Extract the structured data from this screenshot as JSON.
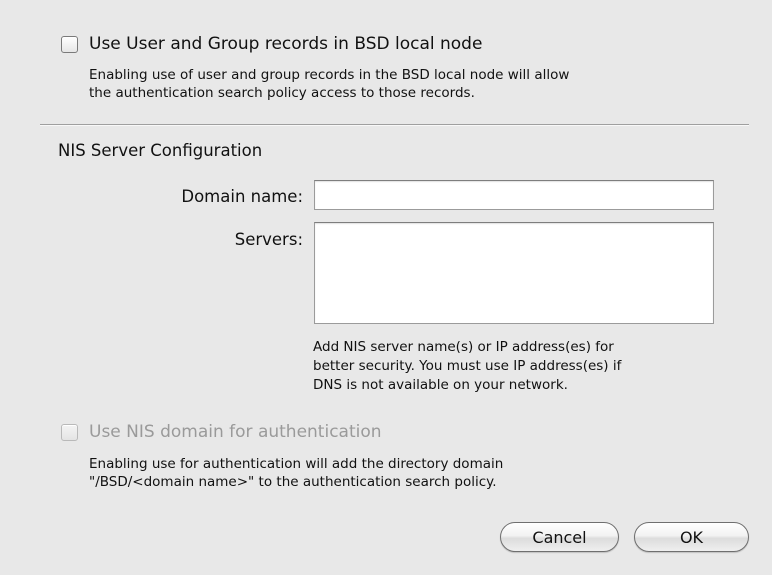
{
  "bsd": {
    "checkbox_label": "Use User and Group records in BSD local node",
    "checked": false,
    "help_lines": [
      "Enabling use of user and group records in the BSD local node will allow",
      "the authentication search policy access to those records."
    ]
  },
  "nis": {
    "section_title": "NIS Server Configuration",
    "domain_label": "Domain name:",
    "domain_value": "",
    "servers_label": "Servers:",
    "servers_value": "",
    "servers_help_lines": [
      "Add NIS server name(s) or IP address(es) for",
      "better security.  You must use IP address(es) if",
      "DNS is not available on your network."
    ]
  },
  "auth": {
    "checkbox_label": "Use NIS domain for authentication",
    "checked": false,
    "enabled": false,
    "help_lines": [
      "Enabling use for authentication will add the directory domain",
      "\"/BSD/<domain name>\" to the authentication search policy."
    ]
  },
  "buttons": {
    "cancel_label": "Cancel",
    "ok_label": "OK"
  }
}
